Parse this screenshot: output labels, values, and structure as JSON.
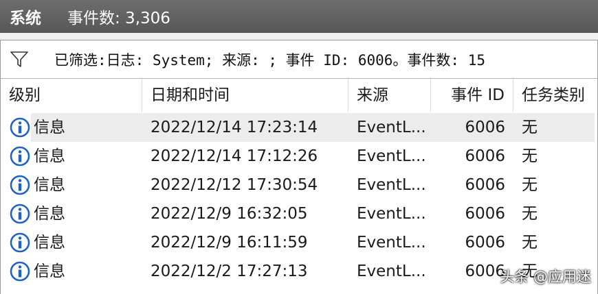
{
  "titlebar": {
    "name": "系统",
    "event_count": "事件数: 3,306"
  },
  "filter": {
    "icon": "funnel-icon",
    "text": "已筛选:日志: System; 来源: ; 事件 ID: 6006。事件数: 15"
  },
  "columns": [
    "级别",
    "日期和时间",
    "来源",
    "事件 ID",
    "任务类别"
  ],
  "rows": [
    {
      "icon": "info-icon",
      "level": "信息",
      "datetime": "2022/12/14 17:23:14",
      "source": "EventL...",
      "event_id": "6006",
      "task": "无"
    },
    {
      "icon": "info-icon",
      "level": "信息",
      "datetime": "2022/12/14 17:12:26",
      "source": "EventL...",
      "event_id": "6006",
      "task": "无"
    },
    {
      "icon": "info-icon",
      "level": "信息",
      "datetime": "2022/12/12 17:30:54",
      "source": "EventL...",
      "event_id": "6006",
      "task": "无"
    },
    {
      "icon": "info-icon",
      "level": "信息",
      "datetime": "2022/12/9 16:32:05",
      "source": "EventL...",
      "event_id": "6006",
      "task": "无"
    },
    {
      "icon": "info-icon",
      "level": "信息",
      "datetime": "2022/12/9 16:11:59",
      "source": "EventL...",
      "event_id": "6006",
      "task": "无"
    },
    {
      "icon": "info-icon",
      "level": "信息",
      "datetime": "2022/12/2 17:27:13",
      "source": "EventL...",
      "event_id": "6006",
      "task": "无"
    }
  ],
  "watermark": "头条 @应用迷",
  "colors": {
    "titlebar": "#5f5f5f",
    "info_icon": "#1e62c8",
    "selected_row": "#ececec"
  }
}
